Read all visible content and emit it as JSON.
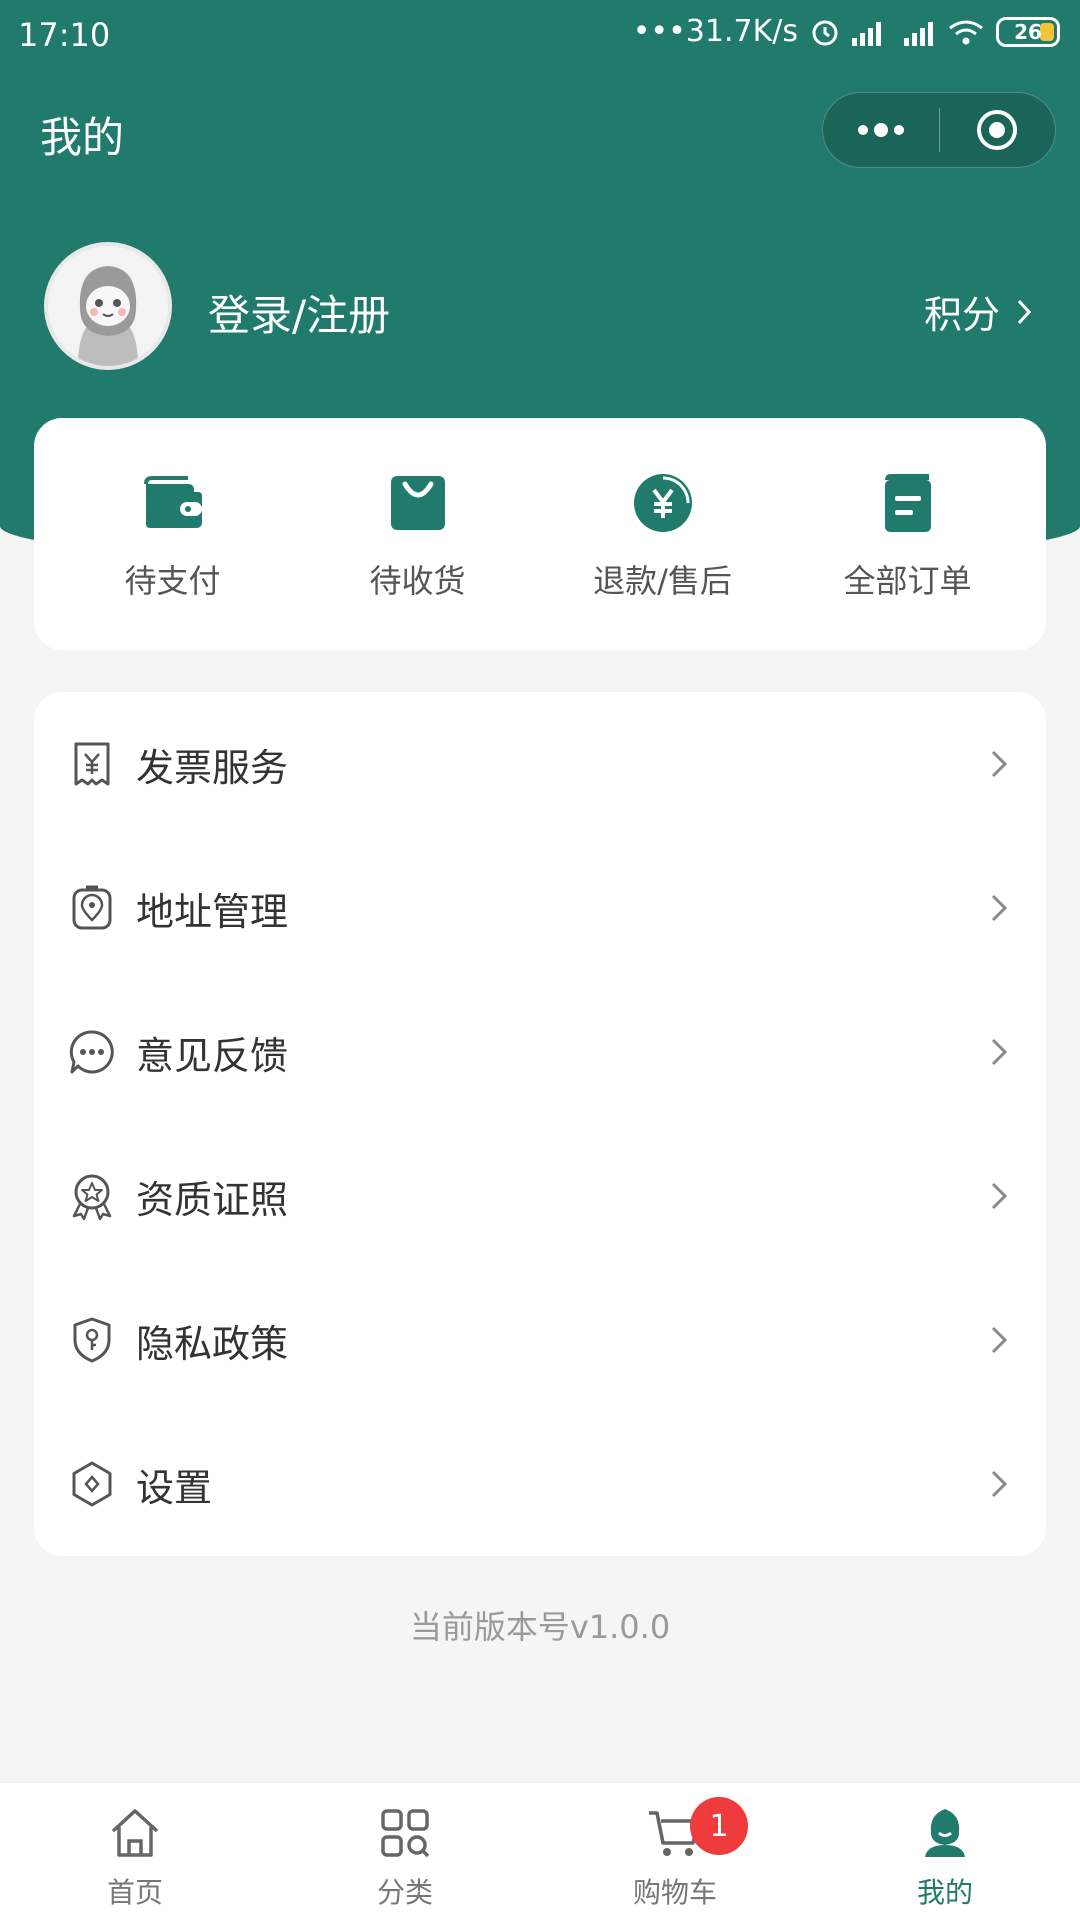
{
  "status_bar": {
    "time": "17:10",
    "network_speed": "31.7K/s",
    "battery": "26"
  },
  "nav": {
    "title": "我的"
  },
  "profile": {
    "login_text": "登录/注册",
    "points_label": "积分"
  },
  "orders": [
    {
      "label": "待支付",
      "icon": "wallet-icon"
    },
    {
      "label": "待收货",
      "icon": "shopping-bag-icon"
    },
    {
      "label": "退款/售后",
      "icon": "refund-yen-icon"
    },
    {
      "label": "全部订单",
      "icon": "order-list-icon"
    }
  ],
  "menu": [
    {
      "label": "发票服务",
      "icon": "invoice-icon"
    },
    {
      "label": "地址管理",
      "icon": "location-icon"
    },
    {
      "label": "意见反馈",
      "icon": "feedback-icon"
    },
    {
      "label": "资质证照",
      "icon": "certificate-icon"
    },
    {
      "label": "隐私政策",
      "icon": "privacy-shield-icon"
    },
    {
      "label": "设置",
      "icon": "settings-icon"
    }
  ],
  "version": "当前版本号v1.0.0",
  "tabs": [
    {
      "label": "首页",
      "icon": "home-icon"
    },
    {
      "label": "分类",
      "icon": "category-icon"
    },
    {
      "label": "购物车",
      "icon": "cart-icon",
      "badge": "1"
    },
    {
      "label": "我的",
      "icon": "profile-icon",
      "active": true
    }
  ],
  "colors": {
    "brand": "#217b6c",
    "background": "#f5f5f5",
    "badge": "#ef3b3b"
  }
}
